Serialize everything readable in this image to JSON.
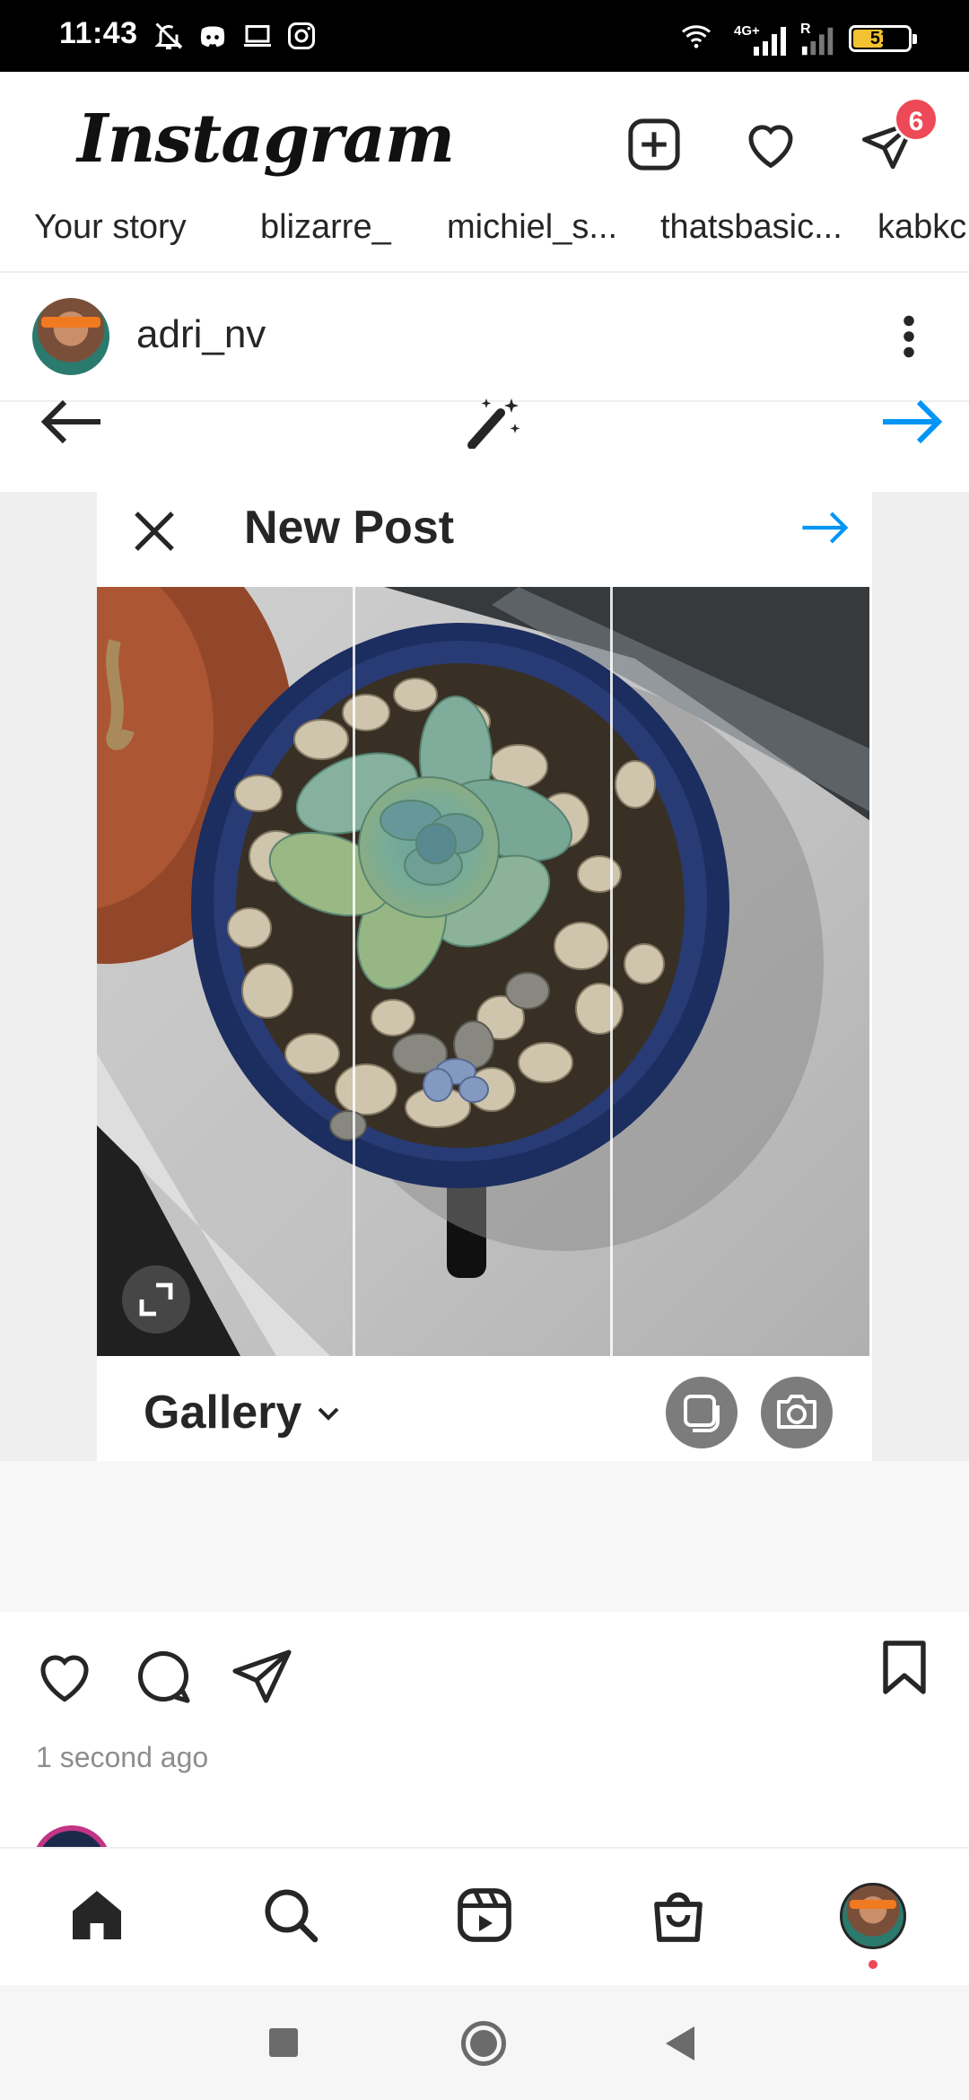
{
  "status_bar": {
    "time": "11:43",
    "icons": [
      "bell-off-icon",
      "discord-icon",
      "laptop-icon",
      "instagram-icon",
      "wifi-icon",
      "signal-4g-icon",
      "signal-roaming-icon"
    ],
    "network_label": "4G+",
    "roaming_label": "R",
    "battery_level": "51",
    "battery_color": "#f2c230"
  },
  "header": {
    "logo": "Instagram",
    "notifications_badge": "6",
    "badge_color": "#ed4956"
  },
  "stories": [
    "Your story",
    "blizarre_",
    "michiel_s...",
    "thatsbasic...",
    "kabkc"
  ],
  "post": {
    "username": "adri_nv",
    "time_ago": "1 second ago"
  },
  "editor": {
    "title": "New Post",
    "gallery_label": "Gallery",
    "accent_color": "#0095f6"
  }
}
